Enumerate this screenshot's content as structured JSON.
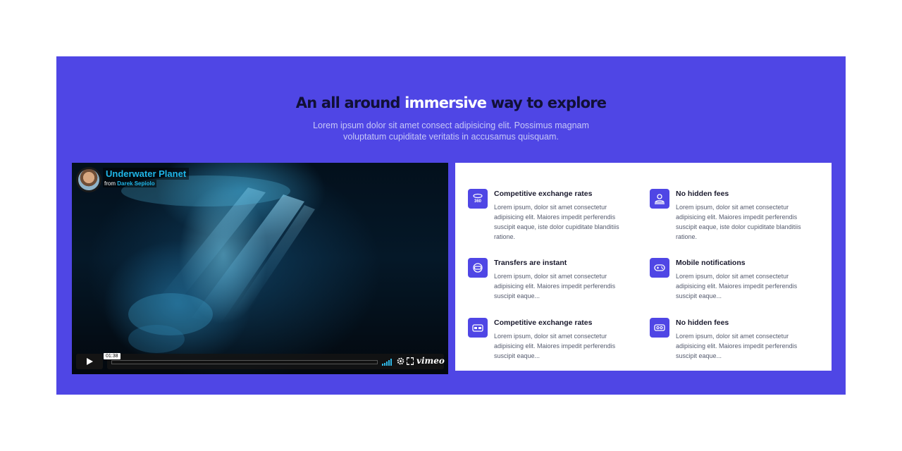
{
  "section": {
    "heading_part1": "An all around ",
    "heading_highlight": "immersive",
    "heading_part2": " way to explore",
    "subtitle": "Lorem ipsum dolor sit amet consect adipisicing elit. Possimus magnam voluptatum cupiditate veritatis in accusamus quisquam."
  },
  "video": {
    "title": "Underwater Planet",
    "by_prefix": "from ",
    "author": "Darek Sepiolo",
    "time": "01:38",
    "brand": "vimeo"
  },
  "features": [
    {
      "title": "Competitive exchange rates",
      "text": "Lorem ipsum, dolor sit amet consectetur adipisicing elit. Maiores impedit perferendis suscipit eaque, iste dolor cupiditate blanditiis ratione.",
      "icon": "vr-360-icon"
    },
    {
      "title": "No hidden fees",
      "text": "Lorem ipsum, dolor sit amet consectetur adipisicing elit. Maiores impedit perferendis suscipit eaque, iste dolor cupiditate blanditiis ratione.",
      "icon": "person-vr-icon"
    },
    {
      "title": "Transfers are instant",
      "text": "Lorem ipsum, dolor sit amet consectetur adipisicing elit. Maiores impedit perferendis suscipit eaque...",
      "icon": "vr-headset-face-icon"
    },
    {
      "title": "Mobile notifications",
      "text": "Lorem ipsum, dolor sit amet consectetur adipisicing elit. Maiores impedit perferendis suscipit eaque...",
      "icon": "gamepad-icon"
    },
    {
      "title": "Competitive exchange rates",
      "text": "Lorem ipsum, dolor sit amet consectetur adipisicing elit. Maiores impedit perferendis suscipit eaque...",
      "icon": "vr-glasses-icon"
    },
    {
      "title": "No hidden fees",
      "text": "Lorem ipsum, dolor sit amet consectetur adipisicing elit. Maiores impedit perferendis suscipit eaque...",
      "icon": "vr-headset-icon"
    }
  ],
  "colors": {
    "brand": "#4f46e5",
    "heading": "#111036",
    "video_accent": "#1fb6e8"
  }
}
